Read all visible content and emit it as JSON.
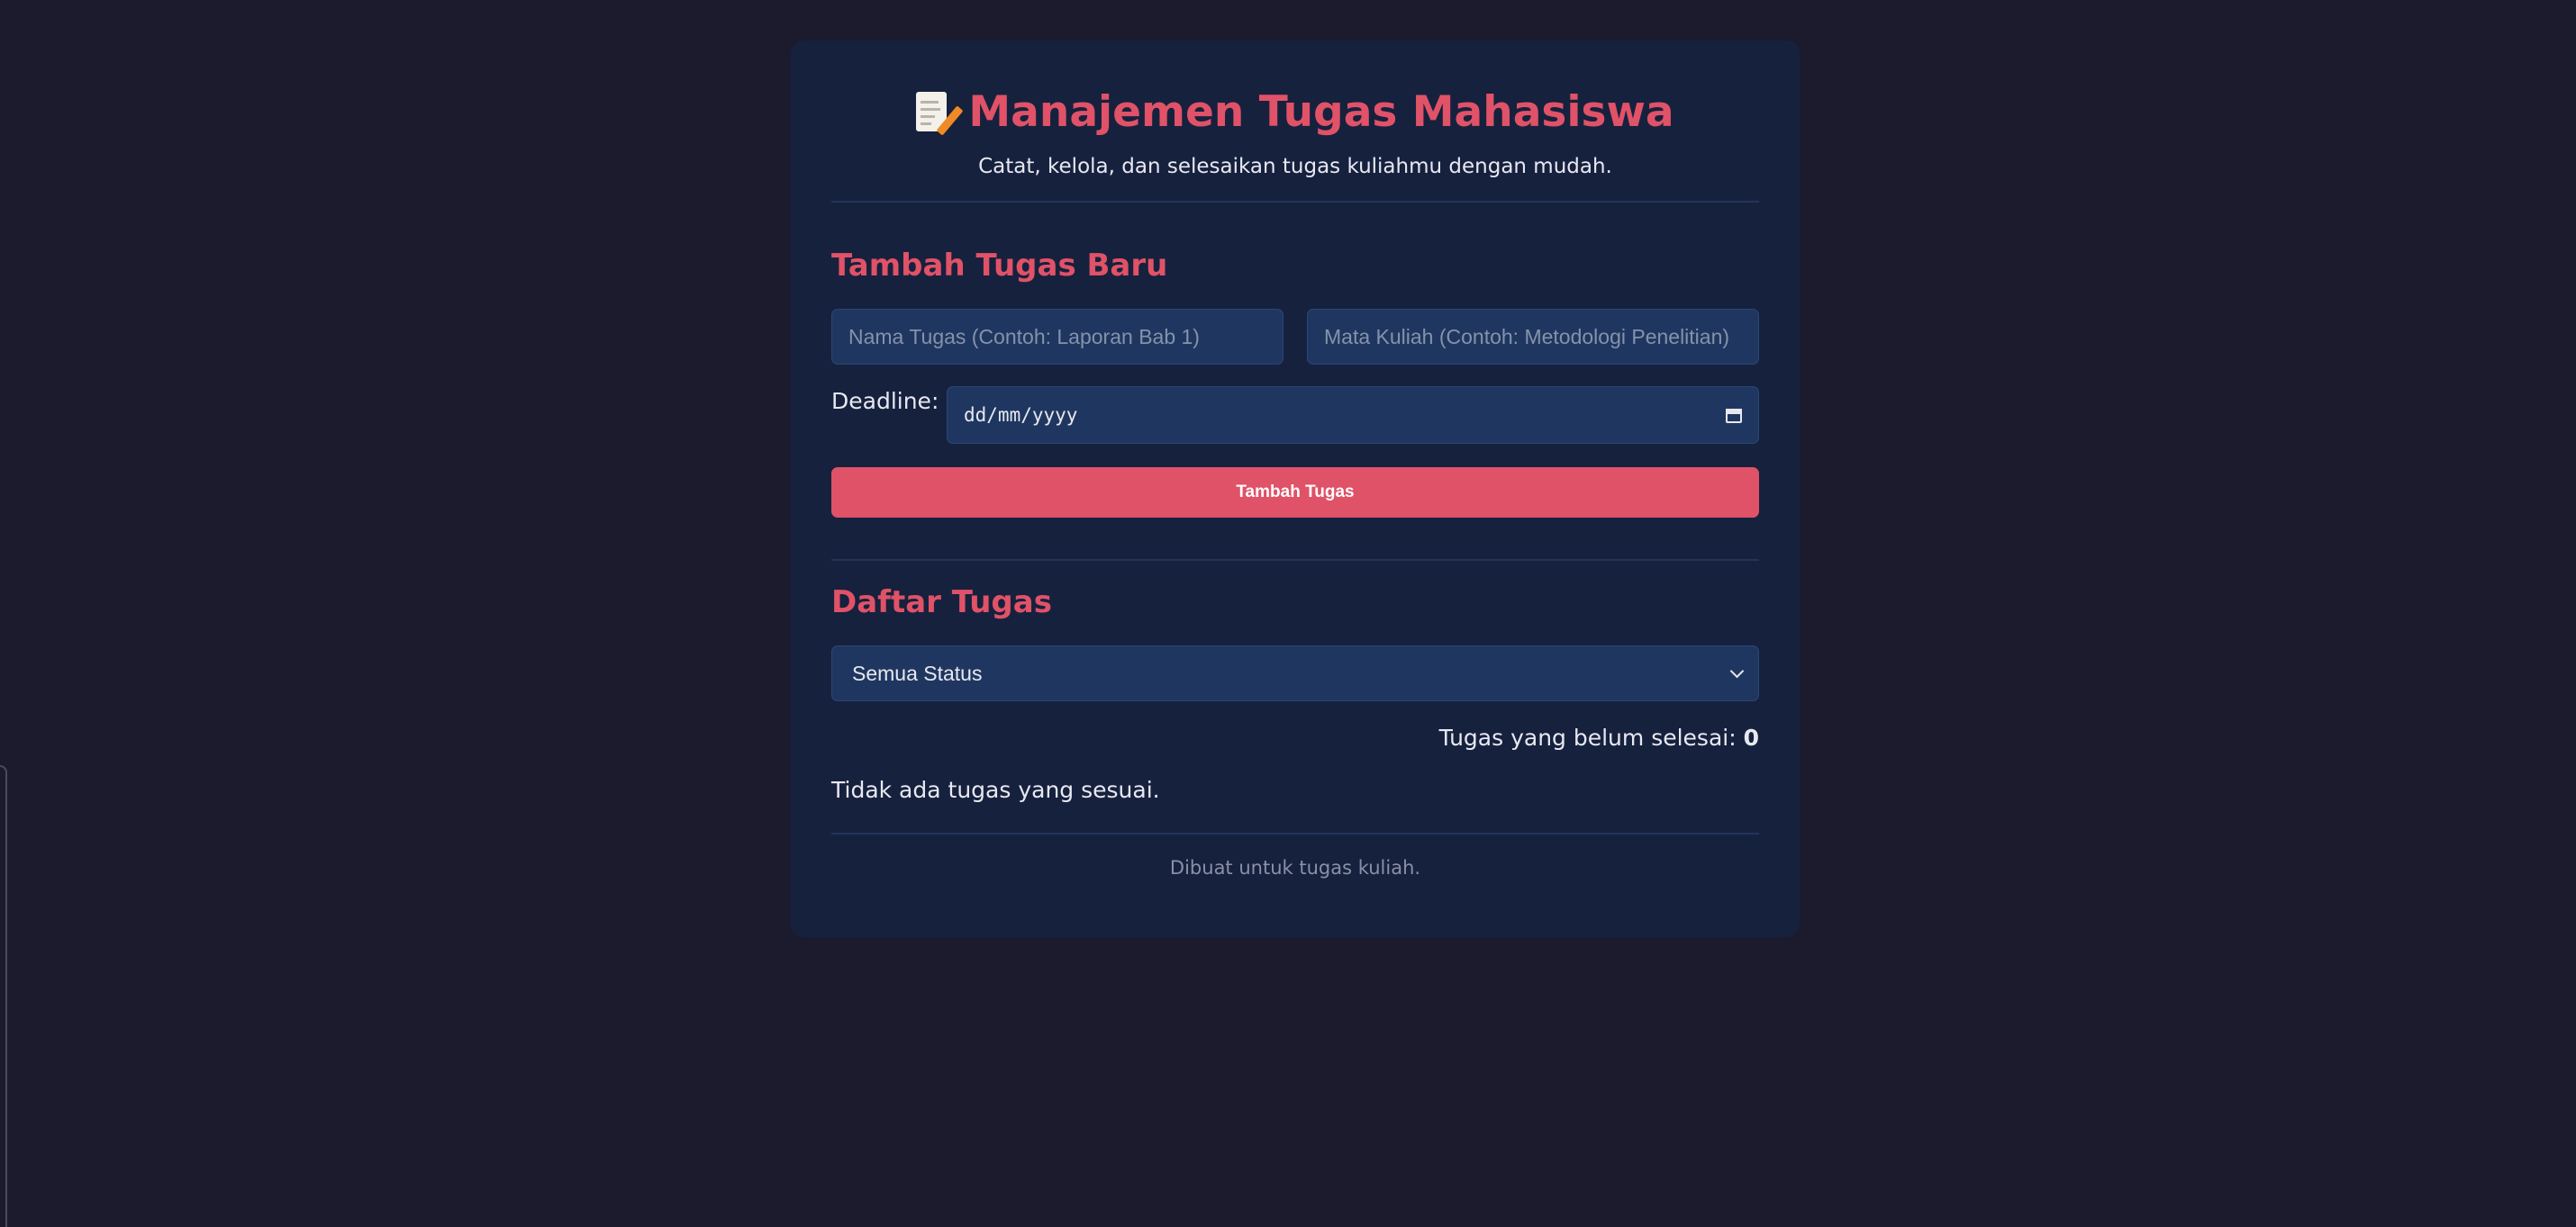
{
  "header": {
    "title": "Manajemen Tugas Mahasiswa",
    "subtitle": "Catat, kelola, dan selesaikan tugas kuliahmu dengan mudah.",
    "icon": "memo-icon"
  },
  "add_section": {
    "title": "Tambah Tugas Baru",
    "task_name_placeholder": "Nama Tugas (Contoh: Laporan Bab 1)",
    "course_placeholder": "Mata Kuliah (Contoh: Metodologi Penelitian)",
    "deadline_label": "Deadline:",
    "date_value": "dd/mm/yyyy",
    "submit_label": "Tambah Tugas"
  },
  "list_section": {
    "title": "Daftar Tugas",
    "status_filter": {
      "selected": "Semua Status"
    },
    "pending_label": "Tugas yang belum selesai:",
    "pending_count": "0",
    "empty_message": "Tidak ada tugas yang sesuai."
  },
  "footer": {
    "text": "Dibuat untuk tugas kuliah."
  },
  "colors": {
    "background": "#1b1b2d",
    "card": "#16213e",
    "accent": "#e05267",
    "input_bg": "#1f3760"
  }
}
